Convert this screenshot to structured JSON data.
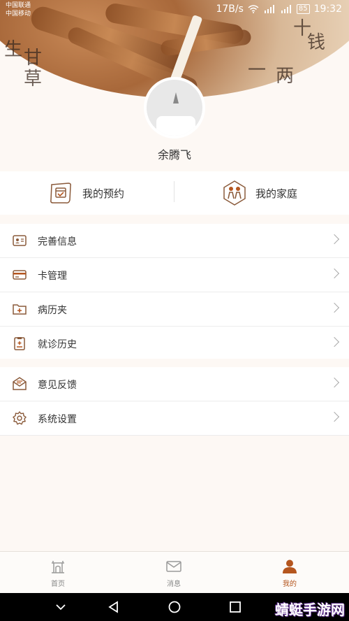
{
  "status_bar": {
    "carrier_1": "中国联通",
    "carrier_2": "中国移动",
    "speed": "17B/s",
    "battery": "85",
    "time": "19:32"
  },
  "banner": {
    "calligraphy": [
      "生",
      "甘",
      "草",
      "一",
      "两",
      "钱",
      "十"
    ]
  },
  "profile": {
    "name": "余腾飞"
  },
  "quick_actions": [
    {
      "label": "我的预约",
      "icon": "appointment-scroll-icon"
    },
    {
      "label": "我的家庭",
      "icon": "family-icon"
    }
  ],
  "menu_group_1": [
    {
      "label": "完善信息",
      "icon": "id-card-icon"
    },
    {
      "label": "卡管理",
      "icon": "card-icon"
    },
    {
      "label": "病历夹",
      "icon": "medical-folder-icon"
    },
    {
      "label": "就诊历史",
      "icon": "clipboard-icon"
    }
  ],
  "menu_group_2": [
    {
      "label": "意见反馈",
      "icon": "feedback-mail-icon"
    },
    {
      "label": "系统设置",
      "icon": "gear-icon"
    }
  ],
  "tabs": [
    {
      "label": "首页",
      "icon": "home-gate-icon"
    },
    {
      "label": "消息",
      "icon": "mail-icon"
    },
    {
      "label": "我的",
      "icon": "person-icon",
      "active": true
    }
  ],
  "watermark": "蜻蜓手游网",
  "colors": {
    "accent": "#b5561f",
    "icon": "#8a5a3a",
    "background": "#fdf8f4"
  }
}
